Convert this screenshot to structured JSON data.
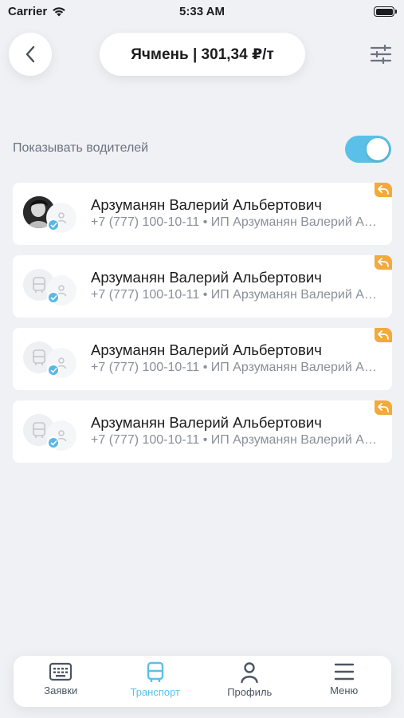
{
  "status_bar": {
    "carrier": "Carrier",
    "time": "5:33 AM"
  },
  "header": {
    "title": "Ячмень | 301,34 ₽/т"
  },
  "toggle": {
    "label": "Показывать водителей",
    "on": true
  },
  "drivers": [
    {
      "name": "Арзуманян Валерий Альбертович",
      "subtitle": "+7 (777) 100-10-11 • ИП Арзуманян Валерий Альбертович",
      "avatar": "photo"
    },
    {
      "name": "Арзуманян Валерий Альбертович",
      "subtitle": "+7 (777) 100-10-11 • ИП Арзуманян Валерий Альбертович",
      "avatar": "bus-icon"
    },
    {
      "name": "Арзуманян Валерий Альбертович",
      "subtitle": "+7 (777) 100-10-11 • ИП Арзуманян Валерий Альбертович",
      "avatar": "bus-icon"
    },
    {
      "name": "Арзуманян Валерий Альбертович",
      "subtitle": "+7 (777) 100-10-11 • ИП Арзуманян Валерий Альбертович",
      "avatar": "bus-icon"
    }
  ],
  "tabs": [
    {
      "label": "Заявки",
      "icon": "keyboard-icon",
      "active": false
    },
    {
      "label": "Транспорт",
      "icon": "bus-icon",
      "active": true
    },
    {
      "label": "Профиль",
      "icon": "person-icon",
      "active": false
    },
    {
      "label": "Меню",
      "icon": "menu-icon",
      "active": false
    }
  ],
  "colors": {
    "accent": "#5bc0e8",
    "badge": "#f3a93b",
    "background": "#f0f1f4"
  }
}
